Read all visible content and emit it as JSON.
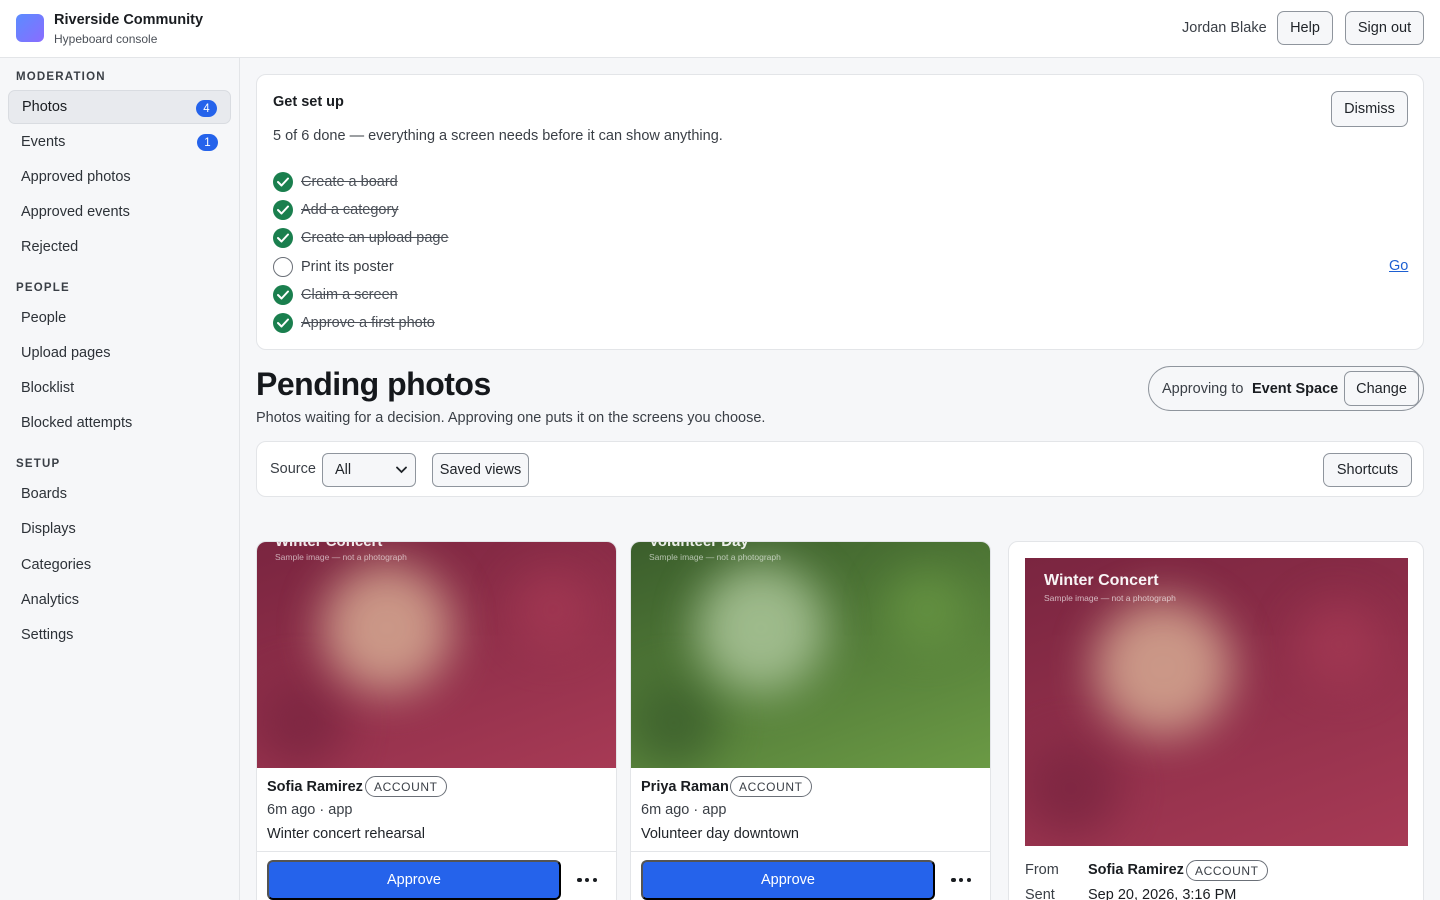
{
  "header": {
    "org_name": "Riverside Community",
    "org_sub": "Hypeboard console",
    "user_name": "Jordan Blake",
    "help_label": "Help",
    "signout_label": "Sign out"
  },
  "sidebar": {
    "sections": [
      {
        "title": "MODERATION",
        "items": [
          {
            "label": "Photos",
            "badge": "4",
            "active": true
          },
          {
            "label": "Events",
            "badge": "1"
          },
          {
            "label": "Approved photos"
          },
          {
            "label": "Approved events"
          },
          {
            "label": "Rejected"
          }
        ]
      },
      {
        "title": "PEOPLE",
        "items": [
          {
            "label": "People"
          },
          {
            "label": "Upload pages"
          },
          {
            "label": "Blocklist"
          },
          {
            "label": "Blocked attempts"
          }
        ]
      },
      {
        "title": "SETUP",
        "items": [
          {
            "label": "Boards"
          },
          {
            "label": "Displays"
          },
          {
            "label": "Categories"
          },
          {
            "label": "Analytics"
          },
          {
            "label": "Settings"
          }
        ]
      }
    ]
  },
  "setup": {
    "title": "Get set up",
    "progress_text": "5 of 6 done — everything a screen needs before it can show anything.",
    "dismiss_label": "Dismiss",
    "go_label": "Go",
    "steps": [
      {
        "label": "Create a board",
        "done": true
      },
      {
        "label": "Add a category",
        "done": true
      },
      {
        "label": "Create an upload page",
        "done": true
      },
      {
        "label": "Print its poster",
        "done": false
      },
      {
        "label": "Claim a screen",
        "done": true
      },
      {
        "label": "Approve a first photo",
        "done": true
      }
    ]
  },
  "pending": {
    "title": "Pending photos",
    "subtitle": "Photos waiting for a decision. Approving one puts it on the screens you choose.",
    "approving_label": "Approving to",
    "approving_target": "Event Space",
    "change_label": "Change"
  },
  "filters": {
    "source_label": "Source",
    "source_value": "All",
    "saved_views_label": "Saved views",
    "shortcuts_label": "Shortcuts"
  },
  "cards": [
    {
      "photo_title": "Winter Concert",
      "photo_note": "Sample image — not a photograph",
      "name": "Sofia Ramirez",
      "tag": "ACCOUNT",
      "meta": "6m ago · app",
      "caption": "Winter concert rehearsal",
      "approve_label": "Approve",
      "colors": {
        "base": "#7a2540",
        "glow": "#d2a38e",
        "accent": "#a73a55"
      }
    },
    {
      "photo_title": "Volunteer Day",
      "photo_note": "Sample image — not a photograph",
      "name": "Priya Raman",
      "tag": "ACCOUNT",
      "meta": "6m ago · app",
      "caption": "Volunteer day downtown",
      "approve_label": "Approve",
      "colors": {
        "base": "#3b5e2c",
        "glow": "#a7c295",
        "accent": "#6b9a45"
      }
    }
  ],
  "detail": {
    "photo_title": "Winter Concert",
    "photo_note": "Sample image — not a photograph",
    "from_key": "From",
    "from_value": "Sofia Ramirez",
    "tag": "ACCOUNT",
    "sent_key": "Sent",
    "sent_value": "Sep 20, 2026, 3:16 PM"
  }
}
